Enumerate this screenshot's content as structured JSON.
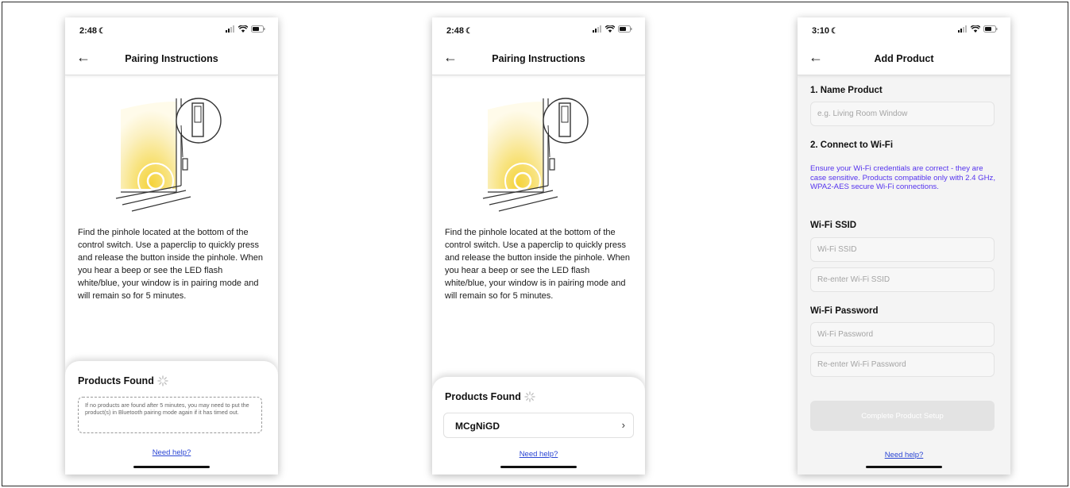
{
  "screens": [
    {
      "status_time": "2:48",
      "title": "Pairing Instructions",
      "instructions": "Find the pinhole located at the bottom of the control switch. Use a paperclip to quickly press and release the button inside the pinhole. When you hear a beep or see the LED flash white/blue, your window is in pairing mode and will remain so for 5 minutes.",
      "products_found_label": "Products Found",
      "notice": "If no products are found after 5 minutes, you may need to put the product(s) in Bluetooth pairing mode again if it has timed out.",
      "help_link": "Need help?"
    },
    {
      "status_time": "2:48",
      "title": "Pairing Instructions",
      "instructions": "Find the pinhole located at the bottom of the control switch. Use a paperclip to quickly press and release the button inside the pinhole. When you hear a beep or see the LED flash white/blue, your window is in pairing mode and will remain so for 5 minutes.",
      "products_found_label": "Products Found",
      "product_name": "MCgNiGD",
      "help_link": "Need help?"
    },
    {
      "status_time": "3:10",
      "title": "Add Product",
      "name_section": "1. Name Product",
      "name_placeholder": "e.g. Living Room Window",
      "wifi_section": "2. Connect to Wi-Fi",
      "wifi_note": "Ensure your Wi-Fi credentials are correct - they are case sensitive. Products compatible only with 2.4 GHz, WPA2-AES secure Wi-Fi connections.",
      "ssid_label": "Wi-Fi SSID",
      "ssid_placeholder": "Wi-Fi SSID",
      "ssid_confirm_placeholder": "Re-enter Wi-Fi SSID",
      "password_label": "Wi-Fi Password",
      "password_placeholder": "Wi-Fi Password",
      "password_confirm_placeholder": "Re-enter Wi-Fi Password",
      "complete_button": "Complete Product Setup",
      "help_link": "Need help?"
    }
  ],
  "colors": {
    "link": "#2a45d4",
    "wifi_note": "#5533ee",
    "disabled_button": "#e3e3e3"
  },
  "icons": [
    "moon-icon",
    "signal-icon",
    "wifi-icon",
    "battery-icon",
    "back-arrow-icon",
    "spinner-icon",
    "chevron-right-icon"
  ]
}
